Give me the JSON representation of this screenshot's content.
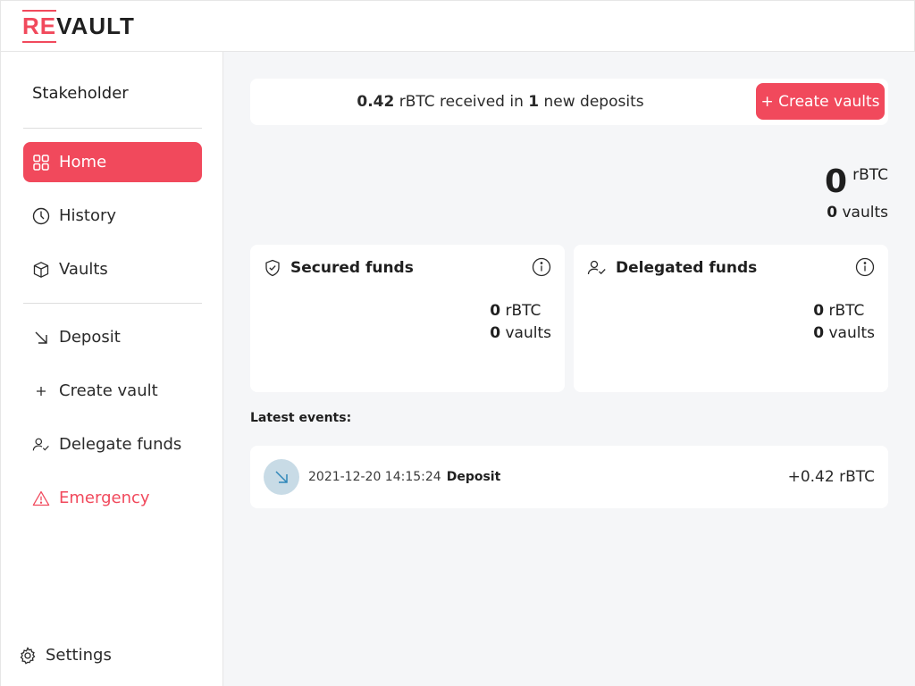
{
  "logo": {
    "part1": "RE",
    "part2": "VAULT"
  },
  "sidebar": {
    "role": "Stakeholder",
    "items": [
      {
        "label": "Home",
        "icon": "grid-icon"
      },
      {
        "label": "History",
        "icon": "clock-icon"
      },
      {
        "label": "Vaults",
        "icon": "box-icon"
      },
      {
        "label": "Deposit",
        "icon": "arrow-down-right-icon"
      },
      {
        "label": "Create vault",
        "icon": "plus-icon"
      },
      {
        "label": "Delegate funds",
        "icon": "user-check-icon"
      },
      {
        "label": "Emergency",
        "icon": "warning-icon"
      }
    ],
    "settings": "Settings"
  },
  "banner": {
    "amount": "0.42",
    "text1": " rBTC received in ",
    "count": "1",
    "text2": " new deposits",
    "button": "+ Create vaults"
  },
  "total": {
    "amount": "0",
    "unit": "rBTC",
    "vaults_count": "0",
    "vaults_label": "vaults"
  },
  "cards": [
    {
      "title": "Secured funds",
      "amount": "0",
      "unit": "rBTC",
      "vaults_count": "0",
      "vaults_label": "vaults"
    },
    {
      "title": "Delegated funds",
      "amount": "0",
      "unit": "rBTC",
      "vaults_count": "0",
      "vaults_label": "vaults"
    }
  ],
  "events": {
    "label": "Latest events:",
    "items": [
      {
        "date": "2021-12-20 14:15:24",
        "type": "Deposit",
        "amount": "+0.42 rBTC"
      }
    ]
  },
  "colors": {
    "accent": "#f1495c",
    "background": "#f5f6f8",
    "deposit_circle": "#c8dbe6"
  }
}
